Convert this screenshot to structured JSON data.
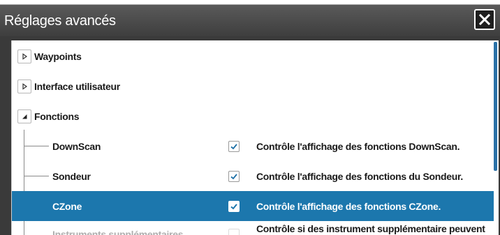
{
  "window": {
    "title": "Réglages avancés",
    "close_icon": "close-icon"
  },
  "tree": {
    "groups": [
      {
        "label": "Waypoints",
        "expanded": false
      },
      {
        "label": "Interface utilisateur",
        "expanded": false
      },
      {
        "label": "Fonctions",
        "expanded": true
      }
    ],
    "children": [
      {
        "label": "DownScan",
        "checked": true,
        "description": "Contrôle l'affichage des fonctions DownScan.",
        "selected": false
      },
      {
        "label": "Sondeur",
        "checked": true,
        "description": "Contrôle l'affichage des fonctions du Sondeur.",
        "selected": false
      },
      {
        "label": "CZone",
        "checked": true,
        "description": "Contrôle l'affichage des fonctions CZone.",
        "selected": true
      },
      {
        "label": "Instruments supplémentaires",
        "checked": false,
        "description": "Contrôle si des instrument supplémentaire peuvent être",
        "selected": false
      }
    ]
  },
  "colors": {
    "selection": "#1c77ad",
    "titlebar": "#3e3e3e",
    "scrollbar": "#2b72a8"
  }
}
